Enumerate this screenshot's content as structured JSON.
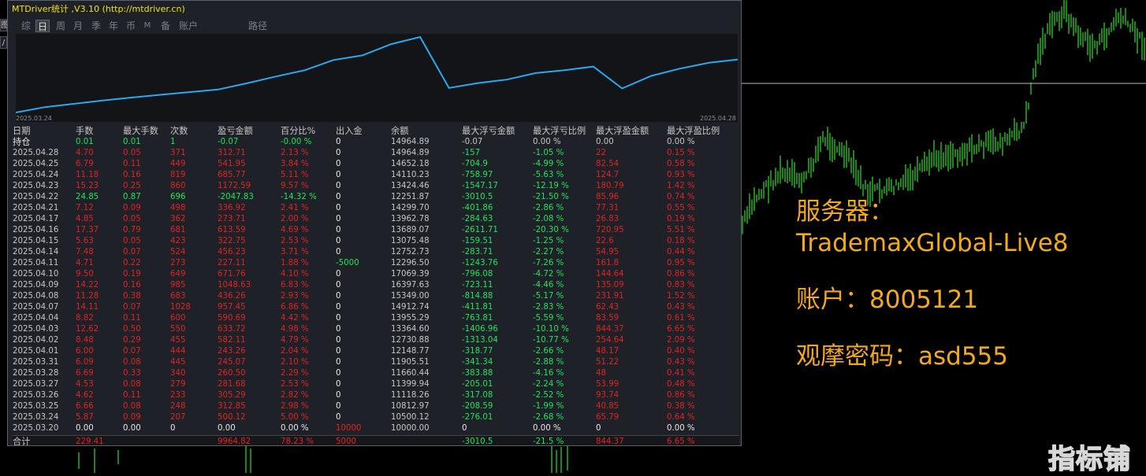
{
  "window": {
    "title": "MTDriver统计 ,V3.10 (http://mtdriver.cn)",
    "left_stub_labels": [
      "图",
      "/"
    ]
  },
  "tabs": [
    {
      "label": "综",
      "active": false
    },
    {
      "label": "日",
      "active": true
    },
    {
      "label": "周",
      "active": false
    },
    {
      "label": "月",
      "active": false
    },
    {
      "label": "季",
      "active": false
    },
    {
      "label": "年",
      "active": false
    },
    {
      "label": "币",
      "active": false
    },
    {
      "label": "M",
      "active": false
    },
    {
      "label": "备",
      "active": false
    },
    {
      "label": "账户",
      "active": false
    },
    {
      "label": "路径",
      "active": false
    }
  ],
  "equity_chart": {
    "start_label": "2025.03.24",
    "end_label": "2025.04.28",
    "line_color": "#2aa9f0",
    "balance_series": [
      10000.0,
      10500.12,
      10812.97,
      11118.26,
      11399.94,
      11660.44,
      11905.51,
      12148.77,
      12730.88,
      13364.6,
      13955.29,
      14912.74,
      15349.0,
      16397.63,
      17069.39,
      12296.5,
      12752.73,
      13075.48,
      13689.07,
      13962.78,
      14299.7,
      12251.87,
      13424.46,
      14110.23,
      14652.18,
      14964.89
    ]
  },
  "table": {
    "headers": [
      "日期",
      "手数",
      "最大手数",
      "次数",
      "盈亏金额",
      "百分比%",
      "出入金",
      "余额",
      "最大浮亏金额",
      "最大浮亏比例",
      "最大浮盈金额",
      "最大浮盈比例"
    ],
    "holding": {
      "label": "持仓",
      "cells": [
        "0.01",
        "0.01",
        "1",
        "-0.07",
        "-0.00 %",
        "0",
        "14964.89",
        "-0.07",
        "0.00 %",
        "0.00",
        "0.00 %"
      ]
    },
    "rows": [
      [
        "2025.04.28",
        "4.70",
        "0.05",
        "371",
        "312.71",
        "2.13 %",
        "0",
        "14964.89",
        "-157",
        "-1.05 %",
        "22",
        "0.15 %"
      ],
      [
        "2025.04.25",
        "6.79",
        "0.11",
        "449",
        "541.95",
        "3.84 %",
        "0",
        "14652.18",
        "-704.9",
        "-4.99 %",
        "82.54",
        "0.58 %"
      ],
      [
        "2025.04.24",
        "11.18",
        "0.16",
        "819",
        "685.77",
        "5.11 %",
        "0",
        "14110.23",
        "-758.97",
        "-5.63 %",
        "124.7",
        "0.93 %"
      ],
      [
        "2025.04.23",
        "15.23",
        "0.25",
        "860",
        "1172.59",
        "9.57 %",
        "0",
        "13424.46",
        "-1547.17",
        "-12.19 %",
        "180.79",
        "1.42 %"
      ],
      [
        "2025.04.22",
        "24.85",
        "0.87",
        "696",
        "-2047.83",
        "-14.32 %",
        "0",
        "12251.87",
        "-3010.5",
        "-21.50 %",
        "85.96",
        "0.74 %"
      ],
      [
        "2025.04.21",
        "7.12",
        "0.09",
        "498",
        "336.92",
        "2.41 %",
        "0",
        "14299.70",
        "-401.86",
        "-2.86 %",
        "77.31",
        "0.55 %"
      ],
      [
        "2025.04.17",
        "4.85",
        "0.05",
        "362",
        "273.71",
        "2.00 %",
        "0",
        "13962.78",
        "-284.63",
        "-2.08 %",
        "26.83",
        "0.19 %"
      ],
      [
        "2025.04.16",
        "17.37",
        "0.79",
        "681",
        "613.59",
        "4.69 %",
        "0",
        "13689.07",
        "-2611.71",
        "-20.30 %",
        "720.95",
        "5.51 %"
      ],
      [
        "2025.04.15",
        "5.63",
        "0.05",
        "423",
        "322.75",
        "2.53 %",
        "0",
        "13075.48",
        "-159.51",
        "-1.25 %",
        "22.6",
        "0.18 %"
      ],
      [
        "2025.04.14",
        "7.48",
        "0.07",
        "524",
        "456.23",
        "3.71 %",
        "0",
        "12752.73",
        "-283.71",
        "-2.27 %",
        "54.95",
        "0.44 %"
      ],
      [
        "2025.04.11",
        "4.71",
        "0.22",
        "273",
        "227.11",
        "1.88 %",
        "-5000",
        "12296.50",
        "-1243.76",
        "-7.26 %",
        "161.8",
        "0.95 %"
      ],
      [
        "2025.04.10",
        "9.50",
        "0.19",
        "649",
        "671.76",
        "4.10 %",
        "0",
        "17069.39",
        "-796.08",
        "-4.72 %",
        "144.64",
        "0.86 %"
      ],
      [
        "2025.04.09",
        "14.22",
        "0.16",
        "985",
        "1048.63",
        "6.83 %",
        "0",
        "16397.63",
        "-723.11",
        "-4.46 %",
        "135.09",
        "0.83 %"
      ],
      [
        "2025.04.08",
        "11.28",
        "0.38",
        "683",
        "436.26",
        "2.93 %",
        "0",
        "15349.00",
        "-814.88",
        "-5.17 %",
        "231.91",
        "1.52 %"
      ],
      [
        "2025.04.07",
        "14.11",
        "0.07",
        "1028",
        "957.45",
        "6.86 %",
        "0",
        "14912.74",
        "-411.81",
        "-2.83 %",
        "62.43",
        "0.43 %"
      ],
      [
        "2025.04.04",
        "8.82",
        "0.11",
        "600",
        "590.69",
        "4.42 %",
        "0",
        "13955.29",
        "-763.81",
        "-5.59 %",
        "83.59",
        "0.61 %"
      ],
      [
        "2025.04.03",
        "12.62",
        "0.50",
        "550",
        "633.72",
        "4.98 %",
        "0",
        "13364.60",
        "-1406.96",
        "-10.10 %",
        "844.37",
        "6.65 %"
      ],
      [
        "2025.04.02",
        "8.48",
        "0.29",
        "455",
        "582.11",
        "4.79 %",
        "0",
        "12730.88",
        "-1313.04",
        "-10.77 %",
        "254.64",
        "2.09 %"
      ],
      [
        "2025.04.01",
        "6.00",
        "0.07",
        "444",
        "243.26",
        "2.04 %",
        "0",
        "12148.77",
        "-318.77",
        "-2.66 %",
        "48.17",
        "0.40 %"
      ],
      [
        "2025.03.31",
        "6.09",
        "0.08",
        "445",
        "245.07",
        "2.10 %",
        "0",
        "11905.51",
        "-341.34",
        "-2.88 %",
        "51.22",
        "0.43 %"
      ],
      [
        "2025.03.28",
        "6.69",
        "0.33",
        "340",
        "260.50",
        "2.29 %",
        "0",
        "11660.44",
        "-383.88",
        "-4.16 %",
        "48",
        "0.41 %"
      ],
      [
        "2025.03.27",
        "4.53",
        "0.08",
        "279",
        "281.68",
        "2.53 %",
        "0",
        "11399.94",
        "-205.01",
        "-2.24 %",
        "53.99",
        "0.48 %"
      ],
      [
        "2025.03.26",
        "4.62",
        "0.11",
        "233",
        "305.29",
        "2.82 %",
        "0",
        "11118.26",
        "-317.08",
        "-2.52 %",
        "93.74",
        "0.86 %"
      ],
      [
        "2025.03.25",
        "6.66",
        "0.08",
        "248",
        "312.85",
        "2.98 %",
        "0",
        "10812.97",
        "-208.59",
        "-1.99 %",
        "40.85",
        "0.38 %"
      ],
      [
        "2025.03.24",
        "5.87",
        "0.09",
        "207",
        "500.12",
        "5.00 %",
        "0",
        "10500.12",
        "-276.01",
        "-2.68 %",
        "65.79",
        "0.64 %"
      ],
      [
        "2025.03.20",
        "0.00",
        "0.00",
        "0",
        "0.00",
        "0.00 %",
        "10000",
        "10000.00",
        "0",
        "0.00 %",
        "0",
        "0.00 %"
      ]
    ],
    "total": {
      "label": "合计",
      "cells": [
        "229.41",
        "",
        "",
        "9964.82",
        "78.23 %",
        "5000",
        "",
        "-3010.5",
        "-21.5 %",
        "844.37",
        "6.65 %"
      ]
    }
  },
  "overlay": {
    "server_label": "服务器：",
    "server_value": "TrademaxGlobal-Live8",
    "account_line": "账户：8005121",
    "password_line": "观摩密码：asd555"
  },
  "watermark": "指标铺",
  "colors": {
    "profit": "#e52222",
    "loss": "#1ee65a",
    "neutral": "#c6c6c6",
    "overlay_text": "#f2a91c",
    "title_text": "#f0e020",
    "candle": "#2ee02a"
  }
}
